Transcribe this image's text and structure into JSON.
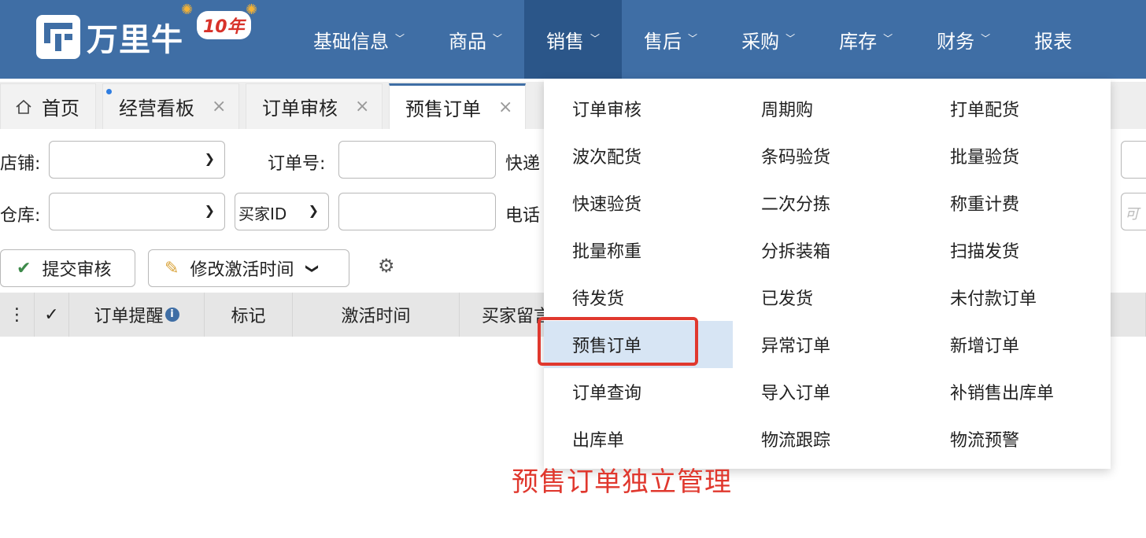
{
  "brand": {
    "name": "万里牛",
    "anniversary": "10年",
    "colors": {
      "nav_bg": "#3f6ea5",
      "nav_active": "#2b5689",
      "highlight": "#e0382e"
    }
  },
  "nav": {
    "items": [
      {
        "label": "基础信息"
      },
      {
        "label": "商品"
      },
      {
        "label": "销售"
      },
      {
        "label": "售后"
      },
      {
        "label": "采购"
      },
      {
        "label": "库存"
      },
      {
        "label": "财务"
      },
      {
        "label": "报表"
      }
    ],
    "chevron": "chevron-down-icon"
  },
  "tabs": [
    {
      "label": "首页",
      "icon": "home-icon"
    },
    {
      "label": "经营看板",
      "close": "×"
    },
    {
      "label": "订单审核",
      "close": "×"
    },
    {
      "label": "预售订单",
      "close": "×"
    }
  ],
  "filters": {
    "shop_label": "店铺:",
    "order_no_label": "订单号:",
    "express_label": "快递",
    "warehouse_label": "仓库:",
    "buyer_select_value": "买家ID",
    "phone_label": "电话",
    "ghost_text": "可"
  },
  "toolbar": {
    "submit_label": "提交审核",
    "modify_label": "修改激活时间",
    "settings_icon": "gear-icon"
  },
  "table": {
    "headers": [
      "订单提醒",
      "标记",
      "激活时间",
      "买家留言"
    ]
  },
  "dropdown": {
    "columns": [
      [
        "订单审核",
        "波次配货",
        "快速验货",
        "批量称重",
        "待发货",
        "预售订单",
        "订单查询",
        "出库单"
      ],
      [
        "周期购",
        "条码验货",
        "二次分拣",
        "分拆装箱",
        "已发货",
        "异常订单",
        "导入订单",
        "物流跟踪"
      ],
      [
        "打单配货",
        "批量验货",
        "称重计费",
        "扫描发货",
        "未付款订单",
        "新增订单",
        "补销售出库单",
        "物流预警"
      ]
    ],
    "highlighted": "预售订单"
  },
  "caption": "预售订单独立管理"
}
